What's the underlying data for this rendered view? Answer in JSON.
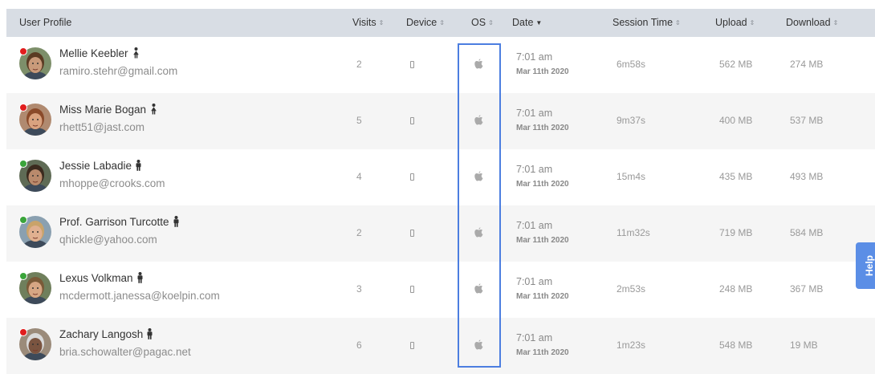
{
  "columns": {
    "user_profile": "User Profile",
    "visits": "Visits",
    "device": "Device",
    "os": "OS",
    "date": "Date",
    "session_time": "Session Time",
    "upload": "Upload",
    "download": "Download"
  },
  "sort_icons": {
    "both": "⇕",
    "desc": "▼"
  },
  "help_label": "Help",
  "colors": {
    "online": "#3aa43a",
    "offline": "#e11d1d",
    "highlight": "#4c7ee0",
    "header_bg": "#d8dde4"
  },
  "rows": [
    {
      "name": "Mellie Keebler",
      "gender": "female",
      "status": "offline",
      "email": "ramiro.stehr@gmail.com",
      "visits": "2",
      "time": "7:01 am",
      "date": "Mar 11th 2020",
      "session": "6m58s",
      "upload": "562 MB",
      "download": "274 MB"
    },
    {
      "name": "Miss Marie Bogan",
      "gender": "female",
      "status": "offline",
      "email": "rhett51@jast.com",
      "visits": "5",
      "time": "7:01 am",
      "date": "Mar 11th 2020",
      "session": "9m37s",
      "upload": "400 MB",
      "download": "537 MB"
    },
    {
      "name": "Jessie Labadie",
      "gender": "male",
      "status": "online",
      "email": "mhoppe@crooks.com",
      "visits": "4",
      "time": "7:01 am",
      "date": "Mar 11th 2020",
      "session": "15m4s",
      "upload": "435 MB",
      "download": "493 MB"
    },
    {
      "name": "Prof. Garrison Turcotte",
      "gender": "male",
      "status": "online",
      "email": "qhickle@yahoo.com",
      "visits": "2",
      "time": "7:01 am",
      "date": "Mar 11th 2020",
      "session": "11m32s",
      "upload": "719 MB",
      "download": "584 MB"
    },
    {
      "name": "Lexus Volkman",
      "gender": "male",
      "status": "online",
      "email": "mcdermott.janessa@koelpin.com",
      "visits": "3",
      "time": "7:01 am",
      "date": "Mar 11th 2020",
      "session": "2m53s",
      "upload": "248 MB",
      "download": "367 MB"
    },
    {
      "name": "Zachary Langosh",
      "gender": "male",
      "status": "offline",
      "email": "bria.schowalter@pagac.net",
      "visits": "6",
      "time": "7:01 am",
      "date": "Mar 11th 2020",
      "session": "1m23s",
      "upload": "548 MB",
      "download": "19 MB"
    }
  ]
}
